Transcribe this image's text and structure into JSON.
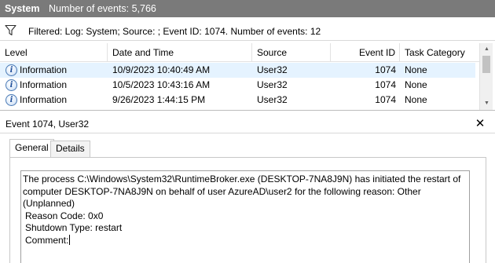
{
  "titlebar": {
    "log_name": "System",
    "event_count": "Number of events: 5,766"
  },
  "filter": {
    "icon": "funnel-icon",
    "text": "Filtered: Log: System; Source: ; Event ID: 1074. Number of events: 12"
  },
  "table": {
    "columns": [
      "Level",
      "Date and Time",
      "Source",
      "Event ID",
      "Task Category"
    ],
    "rows": [
      {
        "level": "Information",
        "datetime": "10/9/2023 10:40:49 AM",
        "source": "User32",
        "event_id": "1074",
        "category": "None"
      },
      {
        "level": "Information",
        "datetime": "10/5/2023 10:43:16 AM",
        "source": "User32",
        "event_id": "1074",
        "category": "None"
      },
      {
        "level": "Information",
        "datetime": "9/26/2023 1:44:15 PM",
        "source": "User32",
        "event_id": "1074",
        "category": "None"
      }
    ],
    "level_icon_glyph": "i"
  },
  "detail": {
    "title": "Event 1074, User32",
    "close_glyph": "✕",
    "tabs": [
      "General",
      "Details"
    ],
    "active_tab": "General",
    "message_lines": [
      "The process C:\\Windows\\System32\\RuntimeBroker.exe (DESKTOP-7NA8J9N) has initiated the restart of",
      "computer DESKTOP-7NA8J9N on behalf of user AzureAD\\user2 for the following reason: Other",
      "(Unplanned)",
      "Reason Code: 0x0",
      "Shutdown Type: restart",
      "Comment:"
    ]
  }
}
